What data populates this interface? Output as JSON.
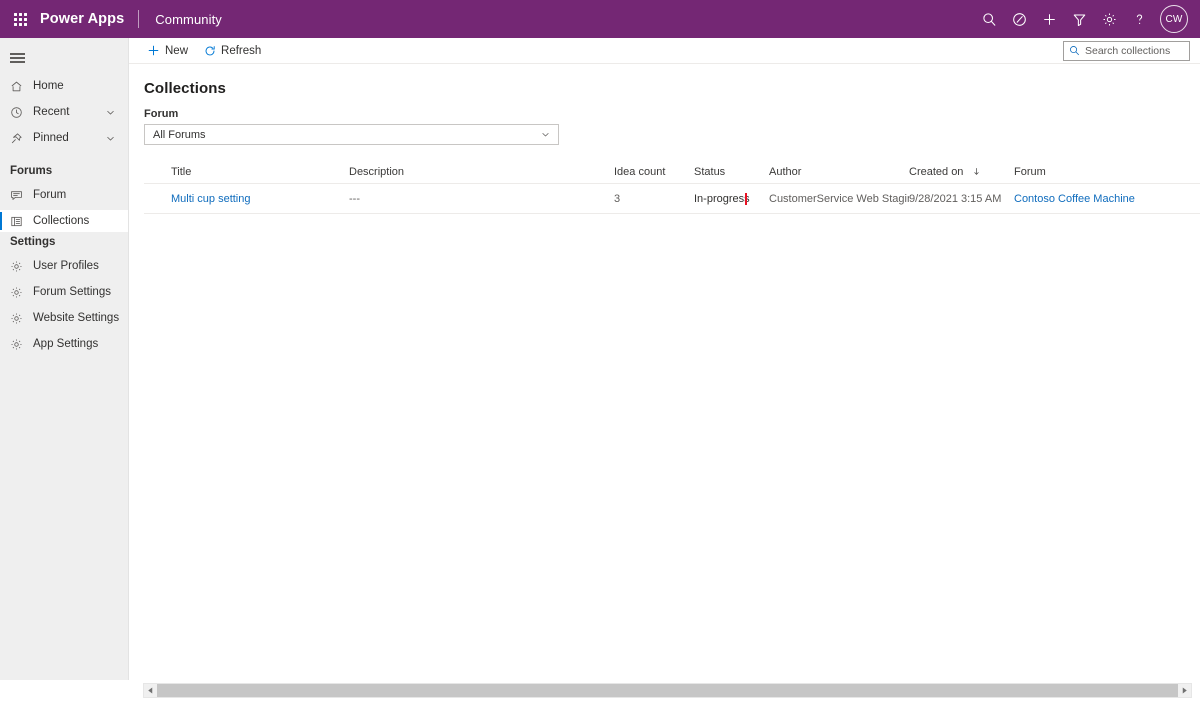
{
  "suite": {
    "waffle_icon": "app-launcher-waffle-icon",
    "brand": "Power Apps",
    "app_name": "Community",
    "actions": [
      {
        "name": "search-icon",
        "label": "Search"
      },
      {
        "name": "environment-icon",
        "label": "Environment"
      },
      {
        "name": "add-icon",
        "label": "New"
      },
      {
        "name": "filter-icon",
        "label": "Filter"
      },
      {
        "name": "settings-gear-icon",
        "label": "Settings"
      },
      {
        "name": "help-icon",
        "label": "Help"
      }
    ],
    "avatar_initials": "CW",
    "background_color": "#742774"
  },
  "sidebar": {
    "hamburger_label": "Site map",
    "primary_items": [
      {
        "label": "Home",
        "icon": "home-icon",
        "expandable": false,
        "selected": false
      },
      {
        "label": "Recent",
        "icon": "clock-icon",
        "expandable": true,
        "selected": false
      },
      {
        "label": "Pinned",
        "icon": "pin-icon",
        "expandable": true,
        "selected": false
      }
    ],
    "groups": [
      {
        "title": "Forums",
        "items": [
          {
            "label": "Forum",
            "icon": "forum-icon",
            "selected": false
          },
          {
            "label": "Collections",
            "icon": "collections-list-icon",
            "selected": true
          }
        ]
      },
      {
        "title": "Settings",
        "items": [
          {
            "label": "User Profiles",
            "icon": "gear-icon",
            "selected": false
          },
          {
            "label": "Forum Settings",
            "icon": "gear-icon",
            "selected": false
          },
          {
            "label": "Website Settings",
            "icon": "gear-icon",
            "selected": false
          },
          {
            "label": "App Settings",
            "icon": "gear-icon",
            "selected": false
          }
        ]
      }
    ],
    "selection_accent_color": "#0078d4"
  },
  "commandbar": {
    "new_label": "New",
    "new_icon": "plus-icon",
    "refresh_label": "Refresh",
    "refresh_icon": "refresh-icon",
    "accent_color": "#0078d4"
  },
  "search": {
    "placeholder": "Search collections",
    "value": "",
    "icon": "search-icon"
  },
  "main": {
    "title": "Collections",
    "filter": {
      "label": "Forum",
      "selected_value": "All Forums",
      "chevron_icon": "chevron-down-icon"
    },
    "grid": {
      "columns": [
        {
          "key": "title",
          "label": "Title",
          "sorted": false
        },
        {
          "key": "description",
          "label": "Description",
          "sorted": false
        },
        {
          "key": "idea_count",
          "label": "Idea count",
          "sorted": false
        },
        {
          "key": "status",
          "label": "Status",
          "sorted": false
        },
        {
          "key": "author",
          "label": "Author",
          "sorted": false
        },
        {
          "key": "created_on",
          "label": "Created on",
          "sorted": true,
          "sort_direction": "descending",
          "sort_icon": "arrow-down-icon"
        },
        {
          "key": "forum",
          "label": "Forum",
          "sorted": false
        }
      ],
      "rows": [
        {
          "title": "Multi cup setting",
          "description": "---",
          "idea_count": "3",
          "status": "In-progress",
          "author": "CustomerService Web Staging",
          "created_on": "9/28/2021 3:15 AM",
          "forum": "Contoso Coffee Machine"
        }
      ]
    },
    "annotation": {
      "target": "status",
      "color": "#e81123"
    }
  },
  "scrollbar": {
    "left_arrow_icon": "caret-left-icon",
    "right_arrow_icon": "caret-right-icon",
    "orientation": "horizontal"
  }
}
